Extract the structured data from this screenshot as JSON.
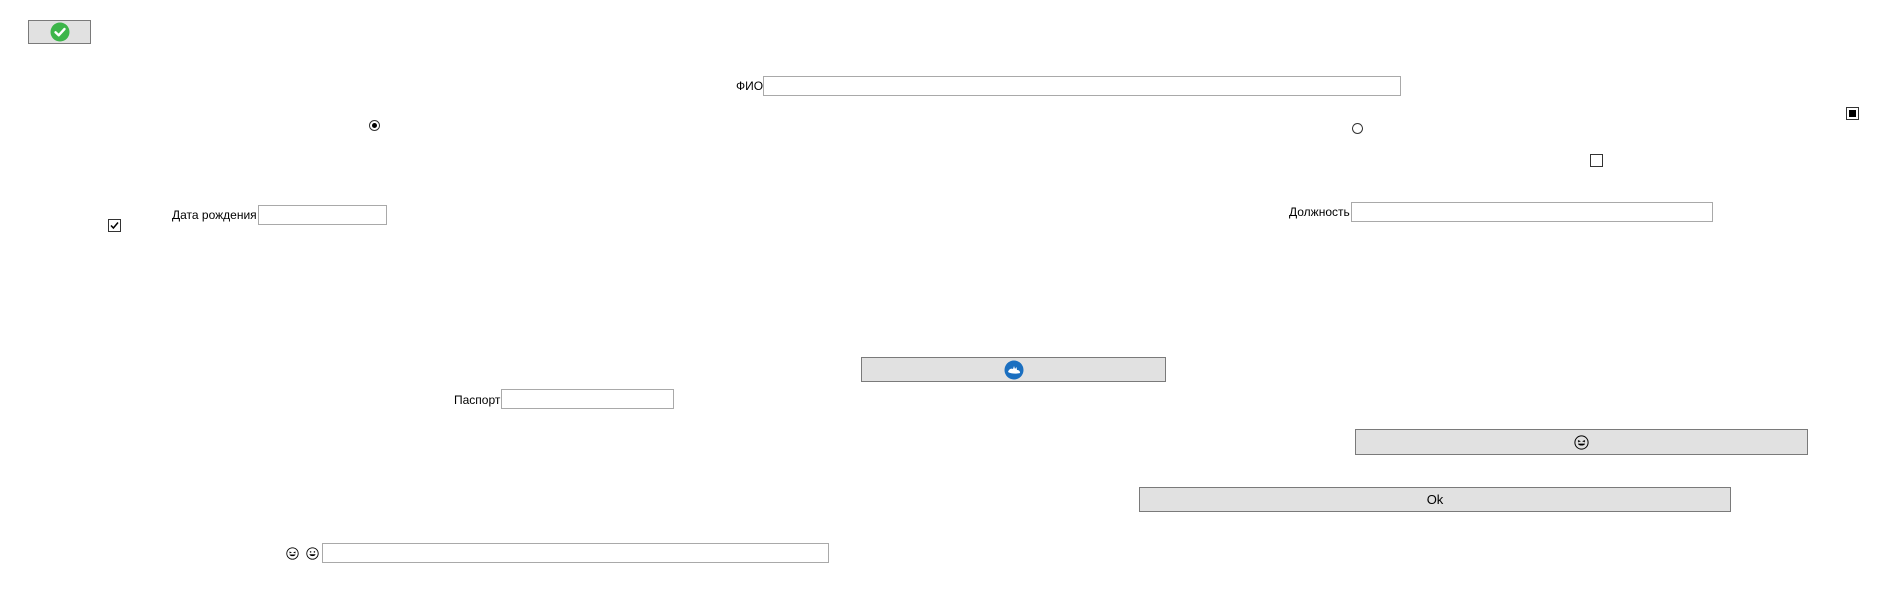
{
  "top_button": {
    "icon": "green-check-circle-icon"
  },
  "fio": {
    "label": "ФИО",
    "value": ""
  },
  "birth_date": {
    "label": "Дата рождения",
    "value": ""
  },
  "position": {
    "label": "Должность",
    "value": ""
  },
  "passport": {
    "label": "Паспорт",
    "value": ""
  },
  "radio_left": {
    "checked": true
  },
  "radio_right": {
    "checked": false
  },
  "checkbox_left": {
    "checked": true
  },
  "checkbox_mid": {
    "checked": false
  },
  "checkbox_right": {
    "state": "indeterminate"
  },
  "image_button": {
    "icon": "blue-circle-logo-icon"
  },
  "emoji_button": {
    "icon": "laughing-face-icon"
  },
  "ok_button": {
    "label": "Ok"
  },
  "bottom_row": {
    "icons": [
      "laughing-face-icon",
      "grinning-face-icon"
    ],
    "value": ""
  },
  "colors": {
    "button_bg": "#e1e1e1",
    "button_border": "#7a7a7a",
    "textbox_border": "#a9a9a9",
    "check_green": "#3db54a",
    "logo_blue": "#1b6fc0"
  }
}
